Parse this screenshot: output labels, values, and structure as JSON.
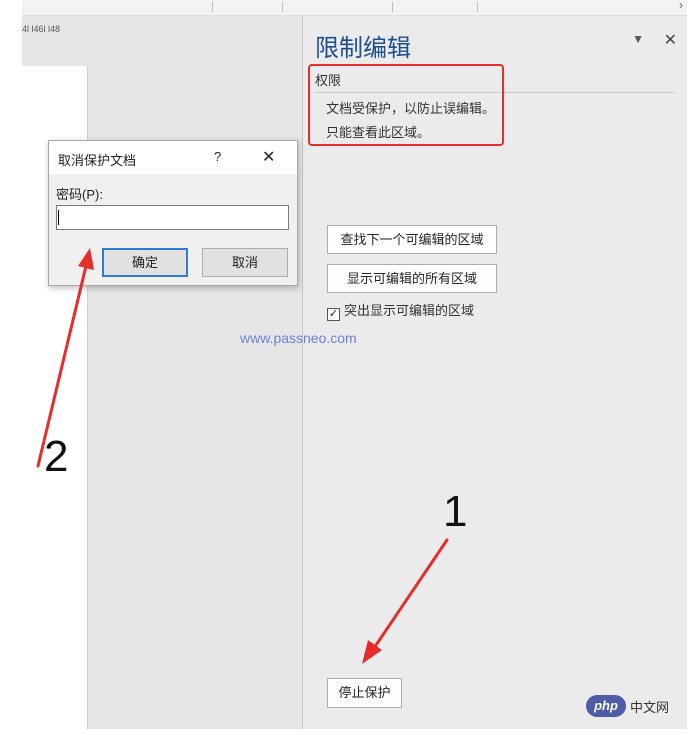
{
  "pane": {
    "title": "限制编辑",
    "permission_header": "权限",
    "permission_line1": "文档受保护，以防止误编辑。",
    "permission_line2": "只能查看此区域。",
    "find_next_label": "查找下一个可编辑的区域",
    "show_all_label": "显示可编辑的所有区域",
    "highlight_label": "突出显示可编辑的区域",
    "highlight_checked": true,
    "stop_protection_label": "停止保护"
  },
  "ruler": {
    "text": "4l  l46l  l48"
  },
  "dialog": {
    "title": "取消保护文档",
    "help": "?",
    "password_label": "密码(P):",
    "password_value": "",
    "ok_label": "确定",
    "cancel_label": "取消"
  },
  "annotations": {
    "step1": "1",
    "step2": "2"
  },
  "watermark": {
    "url": "www.passneo.com",
    "php_logo": "php",
    "php_text": "中文网"
  },
  "colors": {
    "pane_title": "#1f4e8c",
    "annotation_red": "#e82c2c",
    "ok_focus": "#2e7bd6"
  }
}
